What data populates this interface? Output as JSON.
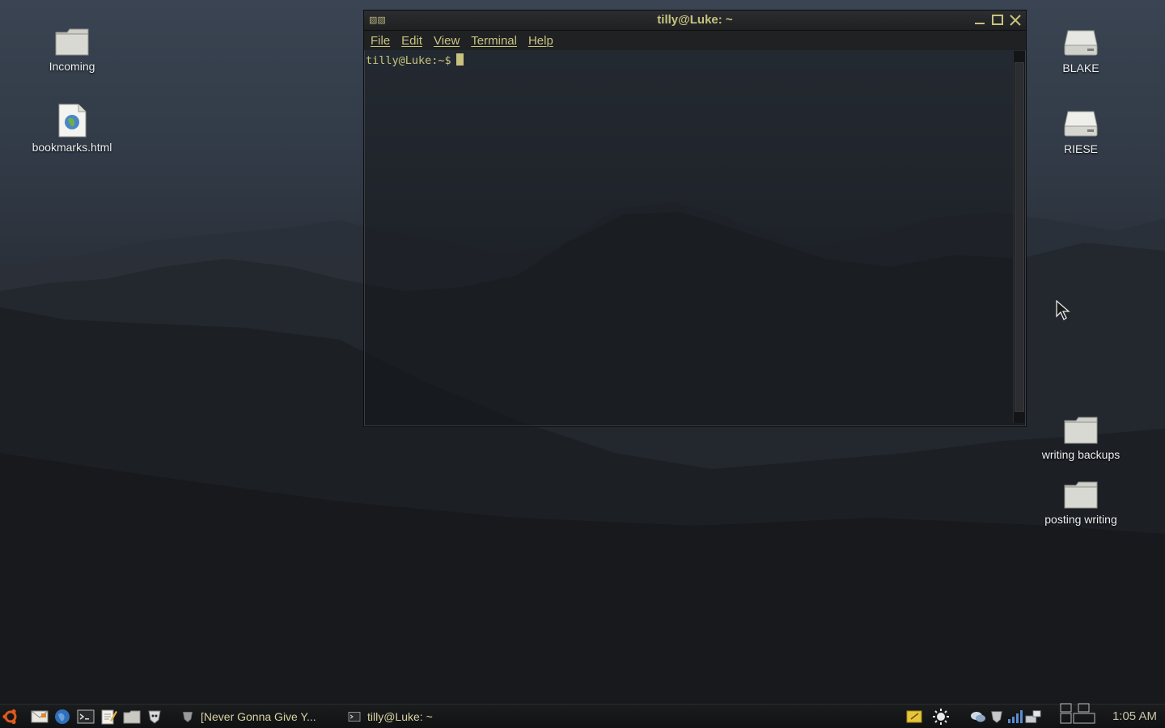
{
  "desktop": {
    "icons_left": [
      {
        "label": "Incoming",
        "icon": "folder-icon"
      },
      {
        "label": "bookmarks.html",
        "icon": "html-file-icon"
      }
    ],
    "icons_right": [
      {
        "label": "BLAKE",
        "icon": "drive-icon"
      },
      {
        "label": "RIESE",
        "icon": "drive-icon"
      },
      {
        "label": "writing backups",
        "icon": "folder-icon"
      },
      {
        "label": "posting writing",
        "icon": "folder-icon"
      }
    ]
  },
  "terminal": {
    "title": "tilly@Luke: ~",
    "menu": [
      "File",
      "Edit",
      "View",
      "Terminal",
      "Help"
    ],
    "prompt": "tilly@Luke:~$"
  },
  "taskbar": {
    "launchers": [
      "ubuntu-menu-icon",
      "mail-icon",
      "browser-globe-icon",
      "terminal-icon",
      "text-editor-icon",
      "file-manager-icon",
      "media-player-icon"
    ],
    "tasks": [
      {
        "label": "[Never Gonna Give Y...",
        "icon": "media-player-icon"
      },
      {
        "label": "tilly@Luke: ~",
        "icon": "terminal-icon"
      }
    ],
    "tray": [
      "notes-icon",
      "weather-icon",
      "chat-icon",
      "shield-icon",
      "signal-icon",
      "network-icon",
      "workspace-switcher-icon"
    ],
    "clock": "1:05 AM"
  },
  "colors": {
    "accent": "#c8c27e",
    "desktop_top": "#3a4452",
    "desktop_bottom": "#17191d"
  }
}
